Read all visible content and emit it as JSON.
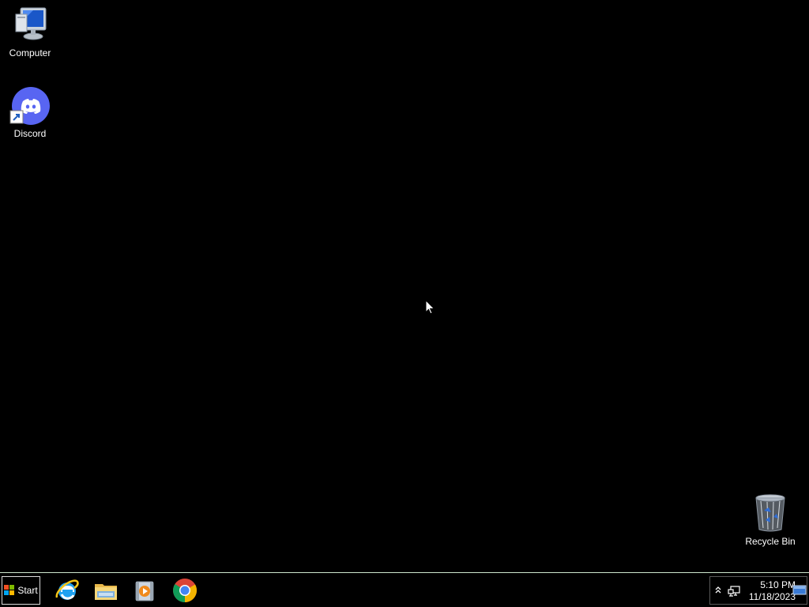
{
  "desktop": {
    "icons": [
      {
        "label": "Computer",
        "icon": "computer-icon"
      },
      {
        "label": "Discord",
        "icon": "discord-icon"
      },
      {
        "label": "Recycle Bin",
        "icon": "recycle-bin-icon"
      }
    ]
  },
  "taskbar": {
    "start_label": "Start",
    "pinned": [
      {
        "icon": "internet-explorer-icon"
      },
      {
        "icon": "file-explorer-icon"
      },
      {
        "icon": "media-player-icon"
      },
      {
        "icon": "chrome-icon"
      }
    ],
    "tray": {
      "time": "5:10 PM",
      "date": "11/18/2023"
    }
  },
  "colors": {
    "desktop_bg": "#000000",
    "taskbar_border": "#cfe7cf",
    "discord_blurple": "#5865f2"
  }
}
